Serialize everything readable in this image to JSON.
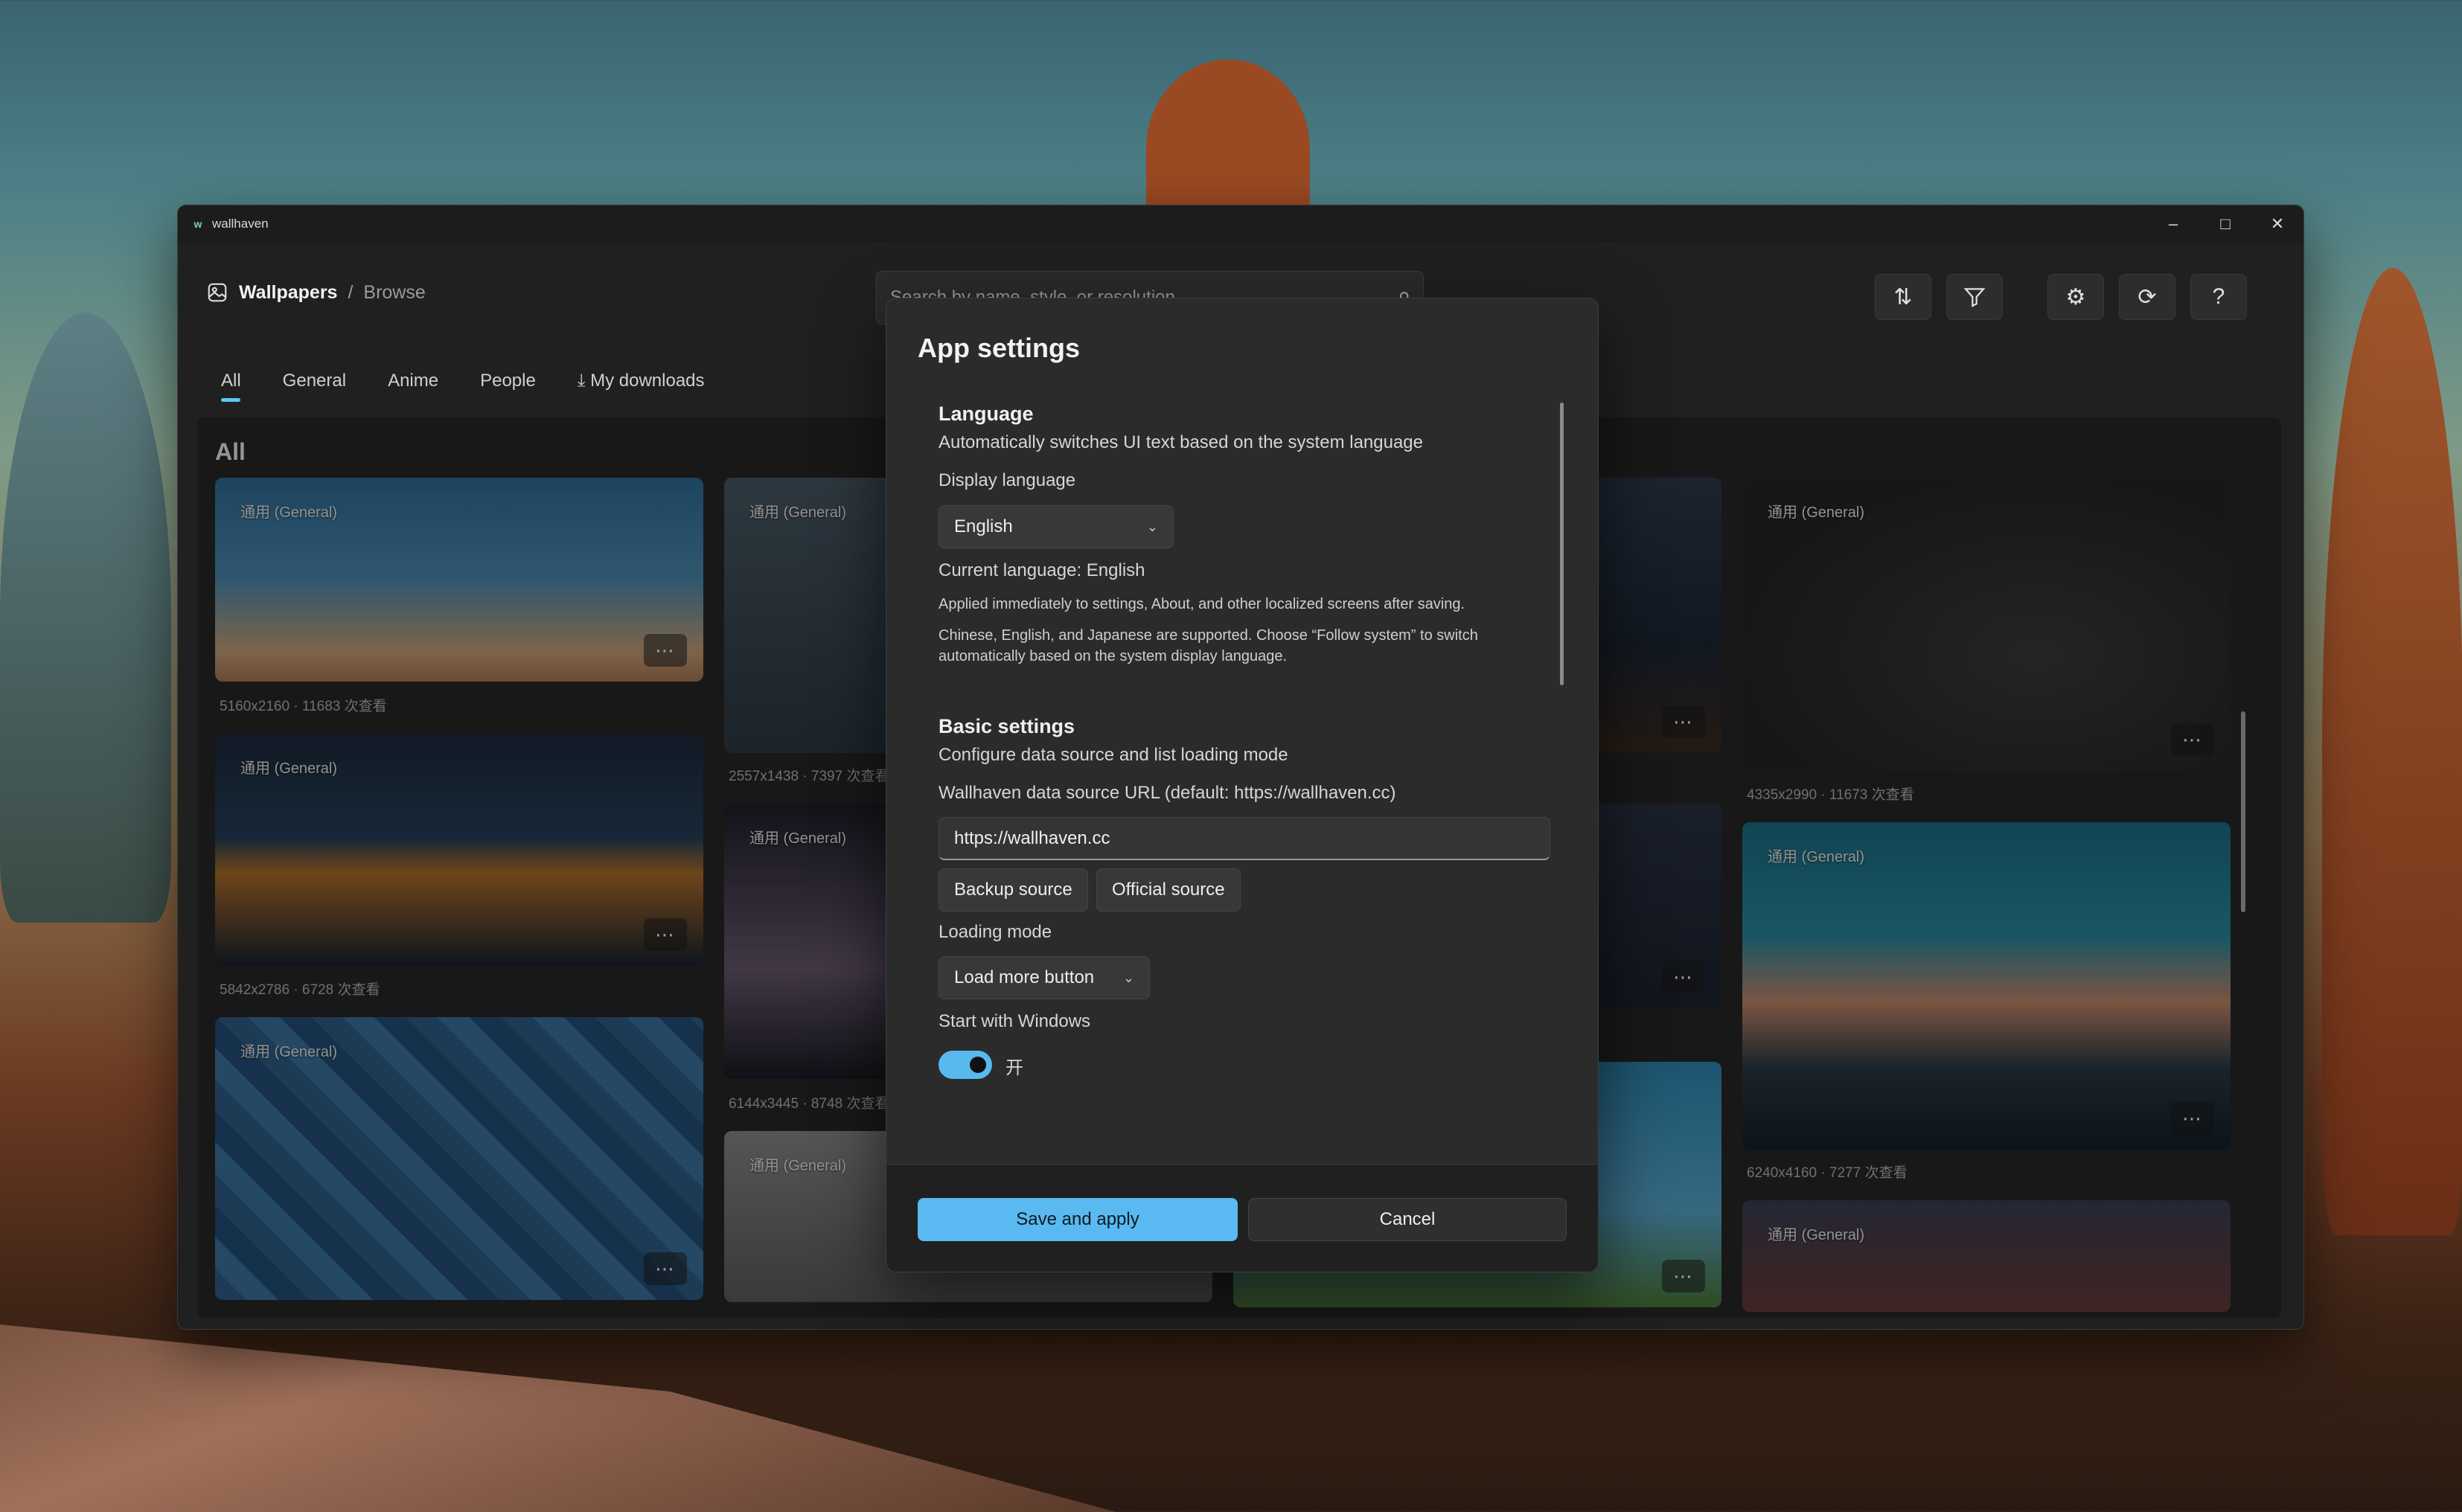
{
  "window": {
    "title": "wallhaven",
    "icon": "app-logo-icon"
  },
  "breadcrumb": {
    "root": "Wallpapers",
    "separator": "/",
    "current": "Browse"
  },
  "search": {
    "placeholder": "Search by name, style, or resolution"
  },
  "toolbar": {
    "icons": [
      "sort-icon",
      "filter-icon",
      "settings-icon",
      "refresh-icon",
      "help-icon"
    ]
  },
  "tabs": [
    {
      "label": "All",
      "active": true
    },
    {
      "label": "General"
    },
    {
      "label": "Anime"
    },
    {
      "label": "People"
    },
    {
      "label": "My downloads",
      "icon": "download-icon"
    }
  ],
  "section": {
    "title": "All"
  },
  "cards": [
    {
      "tag": "通用 (General)",
      "meta": "5160x2160 · 11683 次查看"
    },
    {
      "tag": "通用 (General)",
      "meta": "5842x2786 · 6728 次查看"
    },
    {
      "tag": "通用 (General)",
      "meta": ""
    },
    {
      "tag": "通用 (General)",
      "meta": "2557x1438 · 7397 次查看"
    },
    {
      "tag": "通用 (General)",
      "meta": "6144x3445 · 8748 次查看"
    },
    {
      "tag": "通用 (General)",
      "meta": ""
    },
    {
      "tag": "通用 (General)",
      "meta": "4335x2990 · 11673 次查看"
    },
    {
      "tag": "通用 (General)",
      "meta": "6240x4160 · 7277 次查看"
    },
    {
      "tag": "通用 (General)",
      "meta": ""
    }
  ],
  "dialog": {
    "title": "App settings",
    "language": {
      "heading": "Language",
      "description": "Automatically switches UI text based on the system language",
      "display_label": "Display language",
      "selected": "English",
      "current": "Current language: English",
      "note1": "Applied immediately to settings, About, and other localized screens after saving.",
      "note2a": "Chinese, English, and Japanese are supported. Choose “Follow system” to switch",
      "note2b": "automatically based on the system display language."
    },
    "basic": {
      "heading": "Basic settings",
      "description": "Configure data source and list loading mode",
      "url_label": "Wallhaven data source URL (default: https://wallhaven.cc)",
      "url_value": "https://wallhaven.cc",
      "backup_btn": "Backup source",
      "official_btn": "Official source",
      "loading_label": "Loading mode",
      "loading_value": "Load more button",
      "startup_label": "Start with Windows",
      "startup_state": "开"
    },
    "save": "Save and apply",
    "cancel": "Cancel"
  }
}
